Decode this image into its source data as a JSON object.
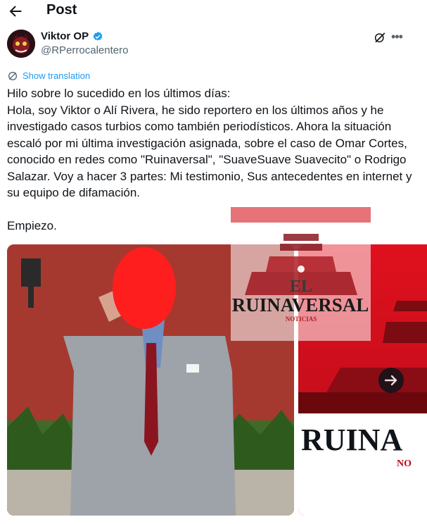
{
  "header": {
    "title": "Post"
  },
  "author": {
    "name": "Viktor OP",
    "handle": "@RPerrocalentero"
  },
  "translation": {
    "label": "Show translation"
  },
  "tweet": {
    "text": "Hilo sobre lo sucedido en los últimos días:\nHola, soy Viktor o Alí Rivera, he sido reportero en los últimos años y he investigado casos turbios como también periodísticos. Ahora la situación escaló por mi última investigación asignada, sobre el caso de Omar Cortes, conocido en redes como \"Ruinaversal\", \"SuaveSuave Suavecito\" o Rodrigo Salazar. Voy a hacer 3 partes: Mi testimonio, Sus antecedentes en internet y su equipo de difamación.\n\nEmpiezo."
  },
  "media": {
    "logo_small": {
      "el": "EL",
      "name": "RUINAVERSAL",
      "sub": "NOTICIAS"
    },
    "logo_large": {
      "name": "RUINA",
      "sub": "NO"
    }
  },
  "colors": {
    "accent": "#1d9bf0",
    "brand_red": "#c00818",
    "verified": "#1d9bf0"
  },
  "icons": {
    "back": "arrow-left-icon",
    "verified": "verified-badge-icon",
    "grok": "grok-icon",
    "more": "more-icon",
    "translate": "translate-icon",
    "next": "arrow-right-icon"
  }
}
